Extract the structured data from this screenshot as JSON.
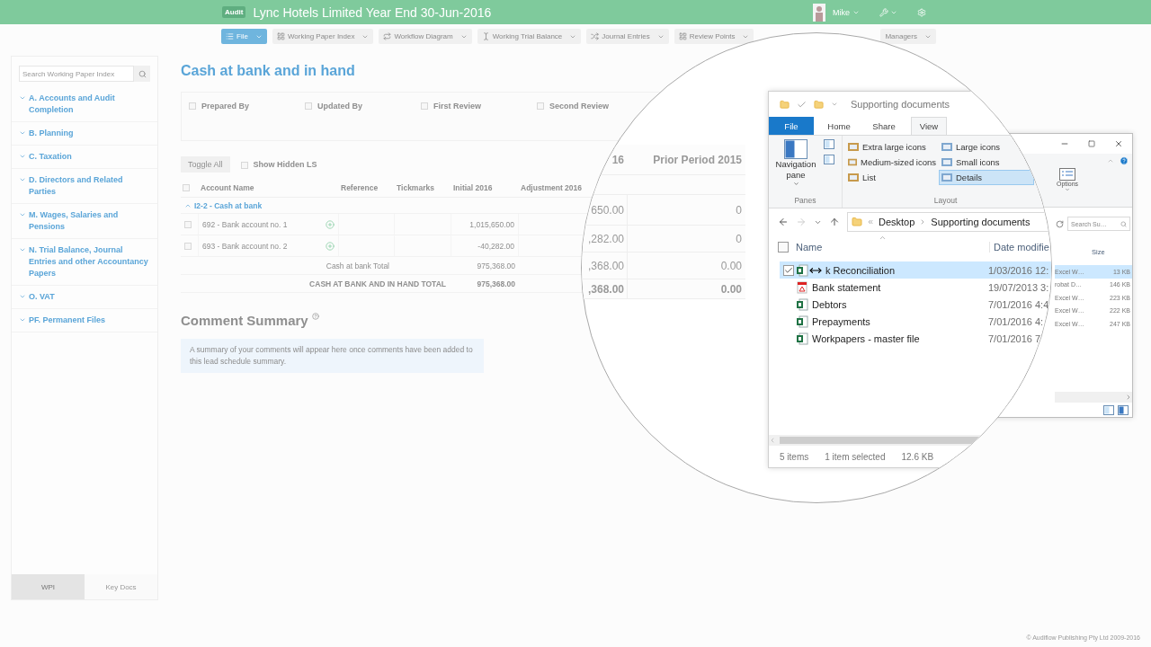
{
  "app_bar": {
    "badge": "Audit",
    "title": "Lync Hotels Limited Year End 30-Jun-2016",
    "user": "Mike"
  },
  "toolbar": [
    {
      "label": "File",
      "kind": "primary"
    },
    {
      "label": "Working Paper Index",
      "kind": "plain"
    },
    {
      "label": "Workflow Diagram",
      "kind": "plain"
    },
    {
      "label": "Working Trial Balance",
      "kind": "plain"
    },
    {
      "label": "Journal Entries",
      "kind": "plain"
    },
    {
      "label": "Review Points",
      "kind": "plain"
    },
    {
      "label": "Managers",
      "kind": "plain"
    }
  ],
  "sidebar": {
    "search_placeholder": "Search Working Paper Index",
    "items": [
      "A. Accounts and Audit Completion",
      "B. Planning",
      "C. Taxation",
      "D. Directors and Related Parties",
      "M. Wages, Salaries and Pensions",
      "N. Trial Balance, Journal Entries and other Accountancy Papers",
      "O. VAT",
      "PF. Permanent Files"
    ],
    "tabs": [
      {
        "label": "WPI",
        "selected": true
      },
      {
        "label": "Key Docs",
        "selected": false
      }
    ]
  },
  "page": {
    "title": "Cash at bank and in hand",
    "signoffs": [
      {
        "label": "Prepared By",
        "checked": false
      },
      {
        "label": "Updated By",
        "checked": false
      },
      {
        "label": "First Review",
        "checked": false
      },
      {
        "label": "Second Review",
        "checked": false
      }
    ],
    "toggle_all": "Toggle All",
    "show_hidden": {
      "label": "Show Hidden LS",
      "checked": false
    },
    "header_checkbox": {
      "checked": false
    },
    "columns": [
      "Account Name",
      "Reference",
      "Tickmarks",
      "Initial 2016",
      "Adjustment 2016"
    ],
    "group": {
      "label": "I2-2 - Cash at bank",
      "expanded": true
    },
    "rows": [
      {
        "name": "692 - Bank account no. 1",
        "initial": "1,015,650.00",
        "checked": false
      },
      {
        "name": "693 - Bank account no. 2",
        "initial": "-40,282.00",
        "checked": false
      }
    ],
    "totals": [
      {
        "label": "Cash at bank Total",
        "initial": "975,368.00",
        "kind": "subtotal"
      },
      {
        "label": "CASH AT BANK AND IN HAND TOTAL",
        "initial": "975,368.00",
        "kind": "grand"
      }
    ],
    "comment_summary": {
      "title": "Comment Summary",
      "note": "A summary of your comments will appear here once comments have been added to this lead schedule summary."
    }
  },
  "magnifier": {
    "columns": [
      "16",
      "Prior Period 2015"
    ],
    "rows": [
      {
        "current": "650.00",
        "prior": "0",
        "kind": "row"
      },
      {
        "current": ",282.00",
        "prior": "0",
        "kind": "row"
      },
      {
        "current": ",368.00",
        "prior": "0.00",
        "kind": "subtotal"
      },
      {
        "current": ",368.00",
        "prior": "0.00",
        "kind": "grand"
      }
    ],
    "explorer": {
      "title": "Supporting documents",
      "tabs": [
        {
          "label": "File",
          "kind": "file",
          "selected": false
        },
        {
          "label": "Home",
          "kind": "tab",
          "selected": false
        },
        {
          "label": "Share",
          "kind": "tab",
          "selected": false
        },
        {
          "label": "View",
          "kind": "tab",
          "selected": true
        }
      ],
      "nav_pane": "Navigation pane",
      "panes_group": "Panes",
      "layout_options": [
        {
          "label": "Extra large icons",
          "selected": false
        },
        {
          "label": "Large icons",
          "selected": false
        },
        {
          "label": "Medium-sized icons",
          "selected": false
        },
        {
          "label": "Small icons",
          "selected": false
        },
        {
          "label": "List",
          "selected": false
        },
        {
          "label": "Details",
          "selected": true
        }
      ],
      "layout_group": "Layout",
      "path": [
        "Desktop",
        "Supporting documents"
      ],
      "header_checkbox": {
        "checked": false
      },
      "columns": [
        "Name",
        "Date modifie"
      ],
      "files": [
        {
          "name": "k Reconciliation",
          "date": "1/03/2016 12:",
          "kind": "excel",
          "selected": true,
          "checked": true
        },
        {
          "name": "Bank statement",
          "date": "19/07/2013 3:",
          "kind": "pdf",
          "selected": false,
          "checked": false
        },
        {
          "name": "Debtors",
          "date": "7/01/2016 4:4",
          "kind": "excel",
          "selected": false,
          "checked": false
        },
        {
          "name": "Prepayments",
          "date": "7/01/2016 4:",
          "kind": "excel",
          "selected": false,
          "checked": false
        },
        {
          "name": "Workpapers - master file",
          "date": "7/01/2016 7",
          "kind": "excel",
          "selected": false,
          "checked": false
        }
      ],
      "status": [
        "5 items",
        "1 item selected",
        "12.6 KB"
      ]
    }
  },
  "back_window": {
    "options": "Options",
    "search_placeholder": "Search Su…",
    "size_column": "Size",
    "files": [
      {
        "type": "Excel W…",
        "size": "13 KB",
        "selected": true
      },
      {
        "type": "robat D…",
        "size": "146 KB",
        "selected": false
      },
      {
        "type": "Excel W…",
        "size": "223 KB",
        "selected": false
      },
      {
        "type": "Excel W…",
        "size": "222 KB",
        "selected": false
      },
      {
        "type": "Excel W…",
        "size": "247 KB",
        "selected": false
      }
    ]
  },
  "footer": "© Audiflow Publishing Pty Ltd 2009-2016"
}
